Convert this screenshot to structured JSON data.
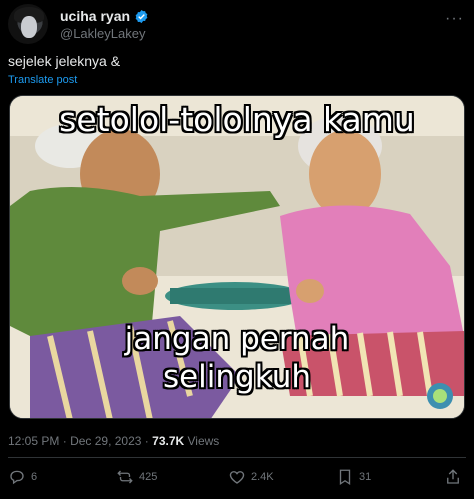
{
  "author": {
    "name": "uciha ryan",
    "handle": "@LakleyLakey",
    "verified_icon": "verified-badge-icon",
    "more_label": "···"
  },
  "post": {
    "text": "sejelek jeleknya &",
    "translate_label": "Translate post"
  },
  "media": {
    "caption_top": "setolol-tololnya kamu",
    "caption_bottom_line1": "jangan pernah",
    "caption_bottom_line2": "selingkuh"
  },
  "meta": {
    "time": "12:05 PM",
    "separator": "·",
    "date": "Dec 29, 2023",
    "views_count": "73.7K",
    "views_label": "Views"
  },
  "actions": {
    "replies": "6",
    "reposts": "425",
    "likes": "2.4K",
    "bookmarks": "31"
  },
  "colors": {
    "background": "#000000",
    "text": "#e7e9ea",
    "muted": "#71767b",
    "link": "#1d9bf0",
    "verified": "#1d9bf0"
  }
}
